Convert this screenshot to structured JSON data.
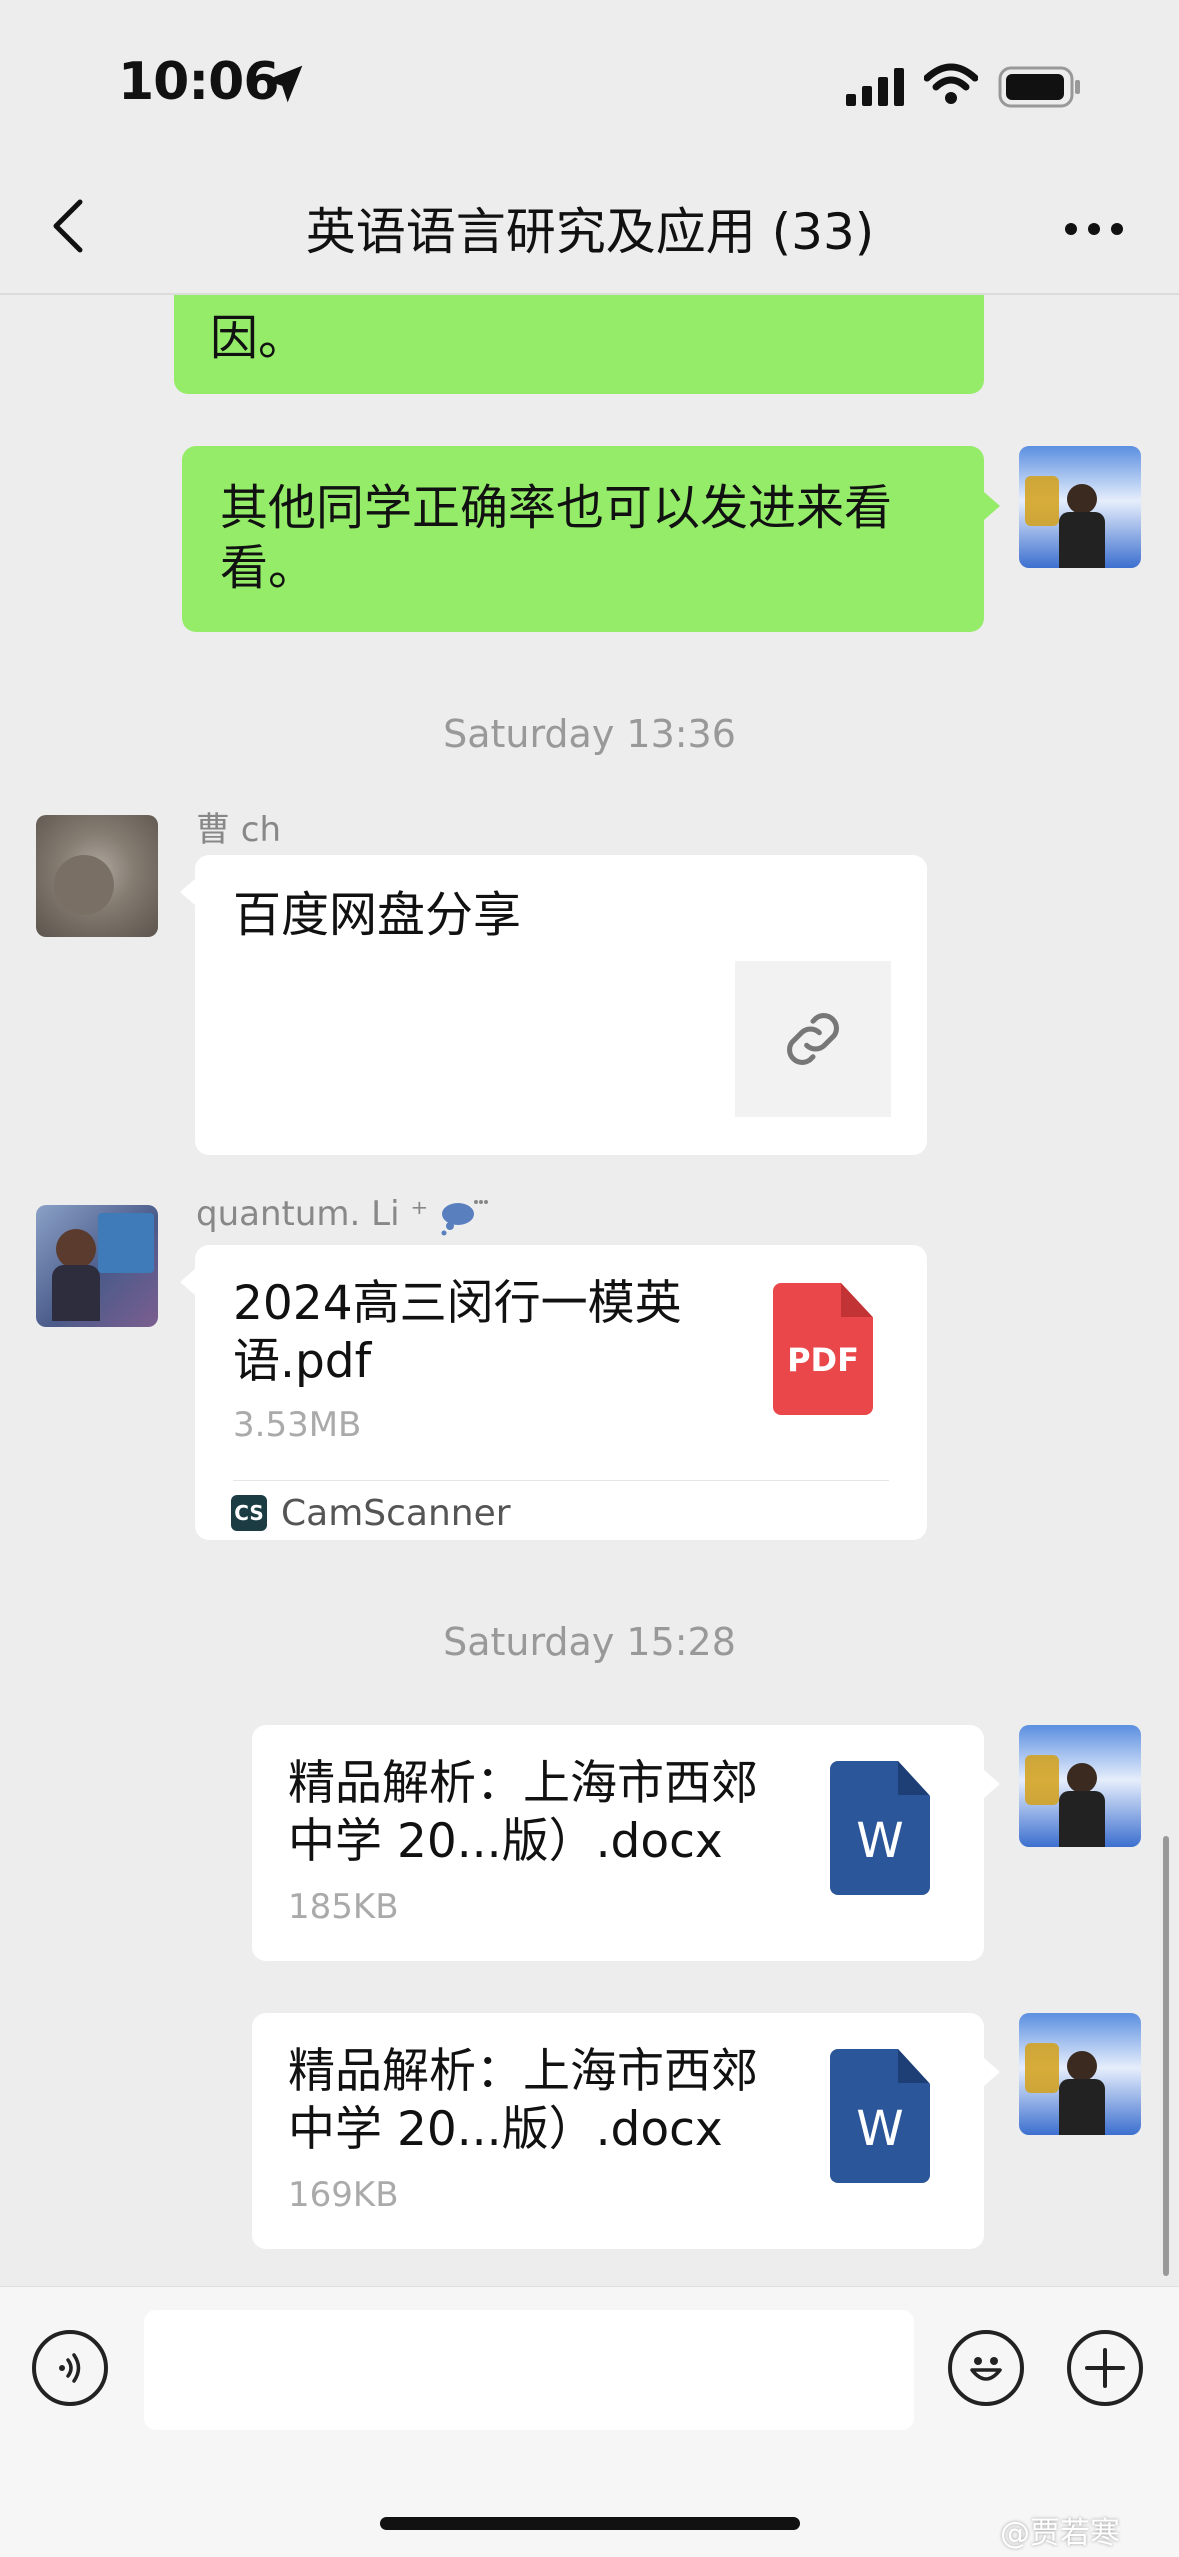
{
  "status_bar": {
    "time": "10:06"
  },
  "header": {
    "title": "英语语言研究及应用 (33)"
  },
  "messages": {
    "partial_text": "因。",
    "self_text_1": "其他同学正确率也可以发进来看看。",
    "time_1": "Saturday 13:36",
    "caoch": {
      "sender": "曹 ch",
      "title": "百度网盘分享"
    },
    "quantum": {
      "sender": "quantum. Li ⁺",
      "file_name": "2024高三闵行一模英语.pdf",
      "file_size": "3.53MB",
      "source": "CamScanner",
      "badge": "PDF"
    },
    "time_2": "Saturday 15:28",
    "doc1": {
      "file_name": "精品解析：上海市西郊中学 20...版）.docx",
      "file_size": "185KB",
      "badge": "W"
    },
    "doc2": {
      "file_name": "精品解析：上海市西郊中学 20...版）.docx",
      "file_size": "169KB",
      "badge": "W"
    }
  },
  "watermark": "@贾若寒",
  "colors": {
    "self_bubble": "#95ec69",
    "pdf": "#e9474a",
    "word": "#2b579a",
    "background": "#ededed"
  }
}
